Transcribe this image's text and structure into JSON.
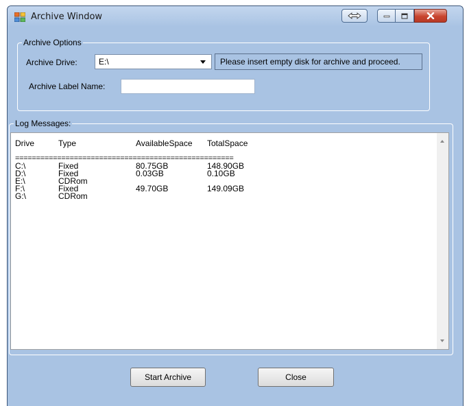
{
  "window": {
    "title": "Archive Window"
  },
  "options": {
    "group_title": "Archive Options",
    "drive_label": "Archive Drive:",
    "drive_selected": "E:\\",
    "notice": "Please insert empty disk for archive and proceed.",
    "label_name_label": "Archive Label Name:",
    "label_name_value": ""
  },
  "log": {
    "group_title": "Log Messages:",
    "headers": [
      "Drive",
      "Type",
      "AvailableSpace",
      "TotalSpace"
    ],
    "separator": "====================================================",
    "rows": [
      {
        "drive": "C:\\",
        "type": "Fixed",
        "available": "80.75GB",
        "total": "148.90GB"
      },
      {
        "drive": "D:\\",
        "type": "Fixed",
        "available": "0.03GB",
        "total": "0.10GB"
      },
      {
        "drive": "E:\\",
        "type": "CDRom",
        "available": "",
        "total": ""
      },
      {
        "drive": "F:\\",
        "type": "Fixed",
        "available": "49.70GB",
        "total": "149.09GB"
      },
      {
        "drive": "G:\\",
        "type": "CDRom",
        "available": "",
        "total": ""
      }
    ]
  },
  "buttons": {
    "start": "Start Archive",
    "close": "Close"
  },
  "colors": {
    "window_bg": "#a9c3e3",
    "close_red": "#c8442e"
  }
}
